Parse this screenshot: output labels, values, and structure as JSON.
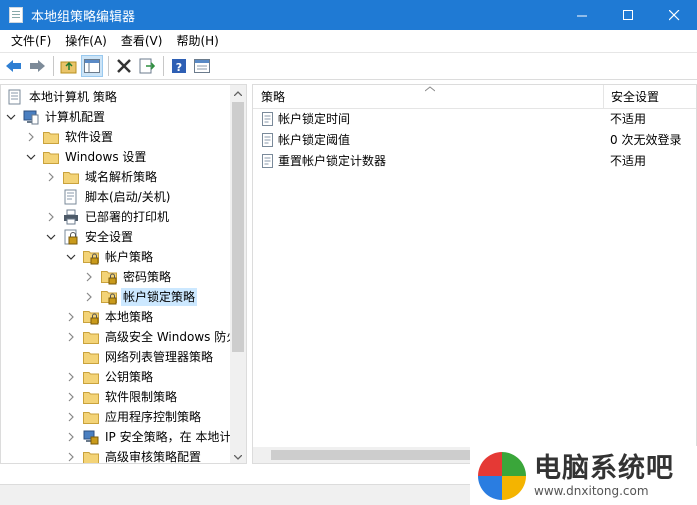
{
  "window": {
    "title": "本地组策略编辑器",
    "accent": "#1f7ad4"
  },
  "menubar": {
    "items": [
      "文件(F)",
      "操作(A)",
      "查看(V)",
      "帮助(H)"
    ]
  },
  "tree": {
    "items": [
      {
        "label": "本地计算机 策略",
        "icon": "computer-policy-icon",
        "expander": "none"
      },
      {
        "label": "计算机配置",
        "icon": "computer-config-icon",
        "expander": "expanded"
      },
      {
        "label": "软件设置",
        "icon": "folder-icon",
        "expander": "collapsed"
      },
      {
        "label": "Windows 设置",
        "icon": "folder-icon",
        "expander": "expanded"
      },
      {
        "label": "域名解析策略",
        "icon": "folder-icon",
        "expander": "collapsed"
      },
      {
        "label": "脚本(启动/关机)",
        "icon": "script-icon",
        "expander": "none"
      },
      {
        "label": "已部署的打印机",
        "icon": "printer-icon",
        "expander": "collapsed"
      },
      {
        "label": "安全设置",
        "icon": "security-icon",
        "expander": "expanded"
      },
      {
        "label": "帐户策略",
        "icon": "locked-folder-icon",
        "expander": "expanded"
      },
      {
        "label": "密码策略",
        "icon": "locked-folder-icon",
        "expander": "collapsed"
      },
      {
        "label": "帐户锁定策略",
        "icon": "locked-folder-icon",
        "expander": "collapsed",
        "selected": true
      },
      {
        "label": "本地策略",
        "icon": "locked-folder-icon",
        "expander": "collapsed"
      },
      {
        "label": "高级安全 Windows 防火",
        "icon": "folder-icon",
        "expander": "collapsed"
      },
      {
        "label": "网络列表管理器策略",
        "icon": "folder-icon",
        "expander": "none"
      },
      {
        "label": "公钥策略",
        "icon": "folder-icon",
        "expander": "collapsed"
      },
      {
        "label": "软件限制策略",
        "icon": "folder-icon",
        "expander": "collapsed"
      },
      {
        "label": "应用程序控制策略",
        "icon": "folder-icon",
        "expander": "collapsed"
      },
      {
        "label": "IP 安全策略，在 本地计",
        "icon": "ip-security-icon",
        "expander": "collapsed"
      },
      {
        "label": "高级审核策略配置",
        "icon": "folder-icon",
        "expander": "collapsed"
      }
    ]
  },
  "list": {
    "columns": {
      "policy": "策略",
      "setting": "安全设置"
    },
    "rows": [
      {
        "policy": "帐户锁定时间",
        "setting": "不适用"
      },
      {
        "policy": "帐户锁定阈值",
        "setting": "0 次无效登录"
      },
      {
        "policy": "重置帐户锁定计数器",
        "setting": "不适用"
      }
    ]
  },
  "watermark": {
    "brand": "电脑系统吧",
    "url": "www.dnxitong.com"
  }
}
